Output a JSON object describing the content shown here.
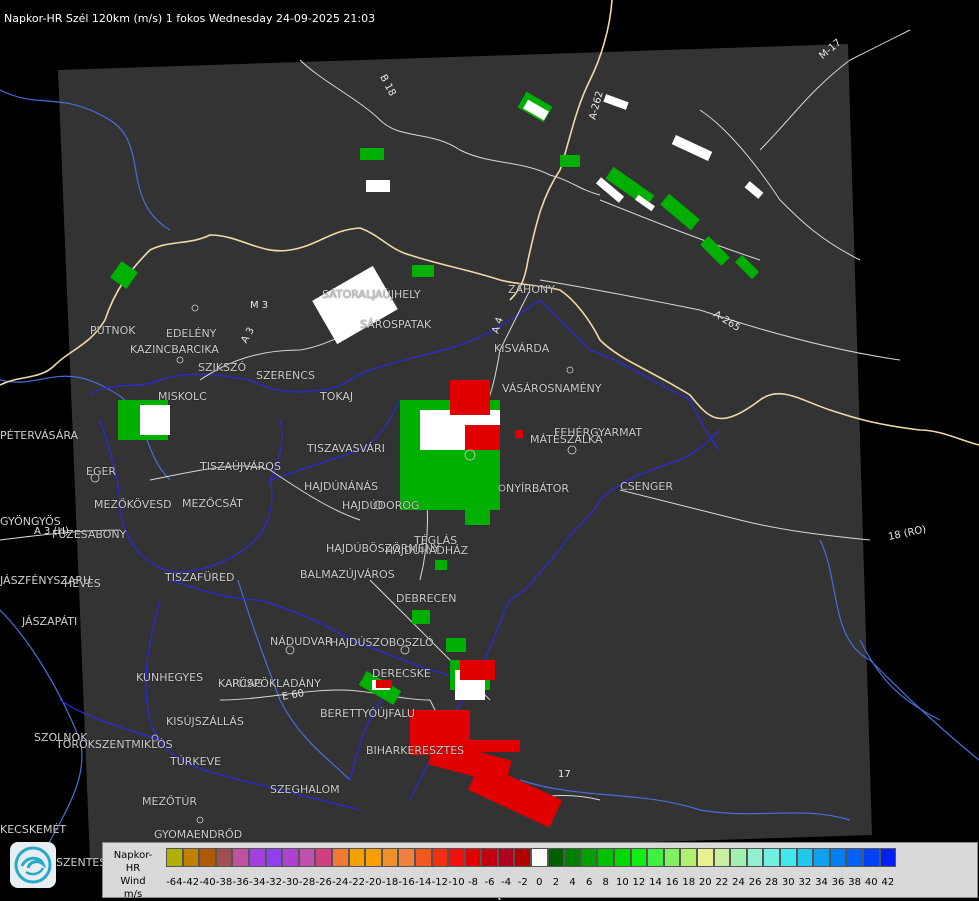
{
  "title": "Napkor-HR Szél 120km (m/s) 1 fokos Wednesday 24-09-2025 21:03",
  "cities": [
    {
      "name": "SÁTORALJAÚJHELY"
    },
    {
      "name": "SÁROSPATAK"
    },
    {
      "name": "ZÁHONY"
    },
    {
      "name": "KISVÁRDA"
    },
    {
      "name": "VÁSÁROSNAMÉNY"
    },
    {
      "name": "FEHÉRGYARMAT"
    },
    {
      "name": "MÁTÉSZALKA"
    },
    {
      "name": "CSENGER"
    },
    {
      "name": "NYÍRBÁTOR"
    },
    {
      "name": "PUTNOK"
    },
    {
      "name": "EDELÉNY"
    },
    {
      "name": "KAZINCBARCIKA"
    },
    {
      "name": "SZIKSZÓ"
    },
    {
      "name": "SZERENCS"
    },
    {
      "name": "TOKAJ"
    },
    {
      "name": "MISKOLC"
    },
    {
      "name": "PÉTERVÁSÁRA"
    },
    {
      "name": "TISZAVASVÁRI"
    },
    {
      "name": "TISZAÚJVÁROS"
    },
    {
      "name": "EGER"
    },
    {
      "name": "HAJDÚNÁNÁS"
    },
    {
      "name": "HAJDÚDOROG"
    },
    {
      "name": "MEZŐKÖVESD"
    },
    {
      "name": "MEZŐCSÁT"
    },
    {
      "name": "GYÖNGYÖS"
    },
    {
      "name": "FÜZESABONY"
    },
    {
      "name": "HAJDÚBÖSZÖRMÉNY"
    },
    {
      "name": "TÉGLÁS"
    },
    {
      "name": "HAJDÚHADHÁZ"
    },
    {
      "name": "BALMAZÚJVÁROS"
    },
    {
      "name": "TISZAFÜRED"
    },
    {
      "name": "HEVES"
    },
    {
      "name": "JÁSZAPÁTI"
    },
    {
      "name": "JÁSZFÉNYSZARU"
    },
    {
      "name": "DEBRECEN"
    },
    {
      "name": "NÁDUDVAR"
    },
    {
      "name": "HAJDÚSZOBOSZLÓ"
    },
    {
      "name": "DERECSKE"
    },
    {
      "name": "KUNHEGYES"
    },
    {
      "name": "KARCAG"
    },
    {
      "name": "PÜSPÖKLADÁNY"
    },
    {
      "name": "BERETTYÓÚJFALU"
    },
    {
      "name": "KISÚJSZÁLLÁS"
    },
    {
      "name": "BIHARKERESZTES"
    },
    {
      "name": "SZOLNOK"
    },
    {
      "name": "TÖRÖKSZENTMIKLÓS"
    },
    {
      "name": "TÚRKEVE"
    },
    {
      "name": "SZEGHALOM"
    },
    {
      "name": "MEZŐTÚR"
    },
    {
      "name": "KECSKEMÉT"
    },
    {
      "name": "GYOMAENDRŐD"
    },
    {
      "name": "SZENTES"
    }
  ],
  "roads": [
    {
      "name": "B 18"
    },
    {
      "name": "A-262"
    },
    {
      "name": "M-17"
    },
    {
      "name": "A-265"
    },
    {
      "name": "18 (RO)"
    },
    {
      "name": "A 3"
    },
    {
      "name": "A 3 (H)"
    },
    {
      "name": "M 3"
    },
    {
      "name": "E 60"
    },
    {
      "name": "A 4"
    },
    {
      "name": "17"
    }
  ],
  "colors": {
    "radar_area": "#333333",
    "border_national": "#f0d8a8",
    "border_county": "#2a2ad8",
    "rivers": "#4a6ed8",
    "roads": "#d8d8d8",
    "negative_velocity": "#e00000",
    "positive_velocity": "#00b000"
  },
  "legend": {
    "title_line1": "Napkor-HR",
    "title_line2": "Wind",
    "unit": "m/s",
    "values": [
      "-64",
      "-42",
      "-40",
      "-38",
      "-36",
      "-34",
      "-32",
      "-30",
      "-28",
      "-26",
      "-24",
      "-22",
      "-20",
      "-18",
      "-16",
      "-14",
      "-12",
      "-10",
      "-8",
      "-6",
      "-4",
      "-2",
      "0",
      "2",
      "4",
      "6",
      "8",
      "10",
      "12",
      "14",
      "16",
      "18",
      "20",
      "22",
      "24",
      "26",
      "28",
      "30",
      "32",
      "34",
      "36",
      "38",
      "40",
      "42"
    ],
    "swatch_colors": [
      "#b0b000",
      "#c08000",
      "#b05a00",
      "#a05050",
      "#c050a0",
      "#a040e0",
      "#9040f0",
      "#b040d0",
      "#c050b0",
      "#d04080",
      "#f07a30",
      "#f8a000",
      "#f8a000",
      "#f0902a",
      "#f08040",
      "#f05a20",
      "#f03010",
      "#f01010",
      "#e00000",
      "#c00010",
      "#b00020",
      "#b00000",
      "#ffffff",
      "#006000",
      "#008000",
      "#00a000",
      "#00c000",
      "#00d800",
      "#10f010",
      "#40f040",
      "#80f060",
      "#b0f070",
      "#e8f090",
      "#c8f0a0",
      "#a0f0b0",
      "#90f0d0",
      "#70f0e0",
      "#40e8f0",
      "#20c8f0",
      "#10a0f0",
      "#0080f0",
      "#0060f8",
      "#0040f8",
      "#0020f0"
    ]
  }
}
